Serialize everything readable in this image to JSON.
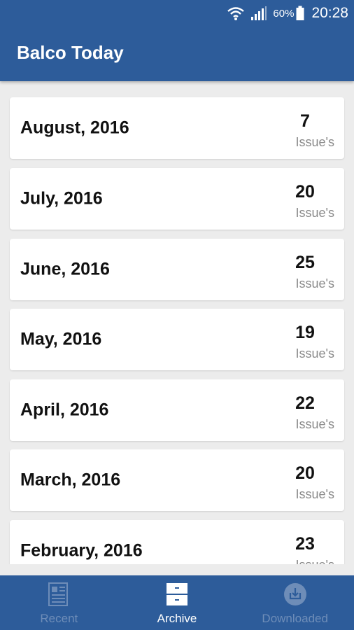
{
  "status_bar": {
    "battery_percent": "60%",
    "time": "20:28",
    "icons": [
      "wifi-icon",
      "signal-icon",
      "battery-icon"
    ]
  },
  "header": {
    "title": "Balco Today"
  },
  "archive": {
    "items": [
      {
        "month": "August, 2016",
        "count": "7",
        "unit": "Issue's"
      },
      {
        "month": "July, 2016",
        "count": "20",
        "unit": "Issue's"
      },
      {
        "month": "June, 2016",
        "count": "25",
        "unit": "Issue's"
      },
      {
        "month": "May, 2016",
        "count": "19",
        "unit": "Issue's"
      },
      {
        "month": "April, 2016",
        "count": "22",
        "unit": "Issue's"
      },
      {
        "month": "March, 2016",
        "count": "20",
        "unit": "Issue's"
      },
      {
        "month": "February, 2016",
        "count": "23",
        "unit": "Issue's"
      }
    ]
  },
  "bottom_nav": {
    "tabs": [
      {
        "label": "Recent",
        "icon": "newspaper-icon",
        "active": false
      },
      {
        "label": "Archive",
        "icon": "archive-box-icon",
        "active": true
      },
      {
        "label": "Downloaded",
        "icon": "download-icon",
        "active": false
      }
    ]
  },
  "colors": {
    "primary": "#2d5c9a",
    "background": "#ececec",
    "card": "#ffffff",
    "inactive_tab": "#6e8db8"
  }
}
